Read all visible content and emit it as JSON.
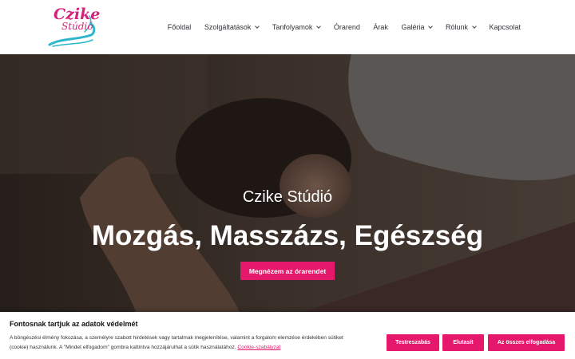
{
  "brand": {
    "logo_line1": "Czike",
    "logo_line2": "Stúdió",
    "accent": "#e5186b"
  },
  "nav": {
    "items": [
      {
        "label": "Főoldal",
        "dropdown": false
      },
      {
        "label": "Szolgáltatások",
        "dropdown": true
      },
      {
        "label": "Tanfolyamok",
        "dropdown": true
      },
      {
        "label": "Órarend",
        "dropdown": false
      },
      {
        "label": "Árak",
        "dropdown": false
      },
      {
        "label": "Galéria",
        "dropdown": true
      },
      {
        "label": "Rólunk",
        "dropdown": true
      },
      {
        "label": "Kapcsolat",
        "dropdown": false
      }
    ]
  },
  "hero": {
    "subtitle": "Czike Stúdió",
    "title": "Mozgás, Masszázs, Egészség",
    "button": "Megnézem az órarendet"
  },
  "cookie": {
    "title": "Fontosnak tartjuk az adatok védelmét",
    "text_line1": "A böngészési élmény fokozása, a személyre szabott hirdetések vagy tartalmak megjelenítése, valamint a forgalom elemzése érdekében sütiket",
    "text_line2": "(cookie) használunk. A \"Mindet elfogadom\" gombra kattintva hozzájárulhat a sütik használatához.",
    "link": "Cookie-szabályzat",
    "btn_customize": "Testreszabás",
    "btn_reject": "Elutasít",
    "btn_accept_all": "Az összes elfogadása"
  }
}
